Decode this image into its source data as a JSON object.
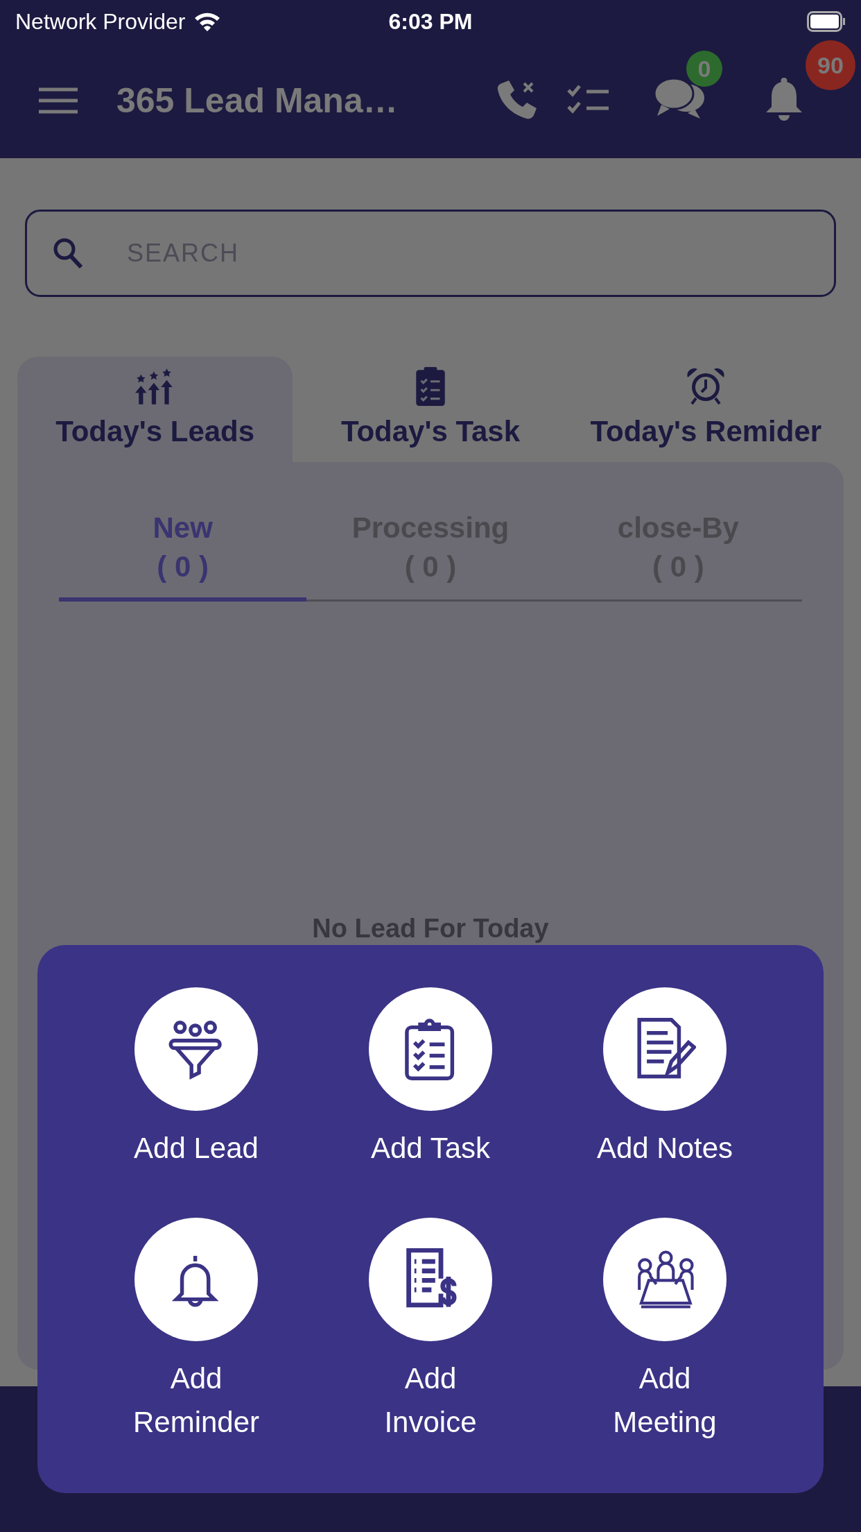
{
  "status_bar": {
    "carrier": "Network Provider",
    "time": "6:03 PM"
  },
  "app_bar": {
    "title": "365 Lead Mana…",
    "badges": [
      {
        "kind": "chat",
        "count": "0",
        "color": "#2d6a2d"
      },
      {
        "kind": "bell",
        "count": "90",
        "color": "#8a2620"
      }
    ]
  },
  "search": {
    "placeholder": "SEARCH"
  },
  "tabs": [
    {
      "label": "Today's Leads",
      "kind": "leads",
      "selected": true
    },
    {
      "label": "Today's Task",
      "kind": "tasks",
      "selected": false
    },
    {
      "label": "Today's Remider",
      "kind": "reminders",
      "selected": false
    }
  ],
  "sub_tabs": [
    {
      "label": "New",
      "count": "( 0 )",
      "selected": true
    },
    {
      "label": "Processing",
      "count": "( 0 )",
      "selected": false
    },
    {
      "label": "close-By",
      "count": "( 0 )",
      "selected": false
    }
  ],
  "empty_message": "No Lead For Today",
  "quick_actions": [
    {
      "label": "Add Lead",
      "kind": "lead"
    },
    {
      "label": "Add Task",
      "kind": "task"
    },
    {
      "label": "Add Notes",
      "kind": "notes"
    },
    {
      "label": "Add Reminder",
      "kind": "reminder"
    },
    {
      "label": "Add Invoice",
      "kind": "invoice"
    },
    {
      "label": "Add Meeting",
      "kind": "meeting"
    }
  ]
}
